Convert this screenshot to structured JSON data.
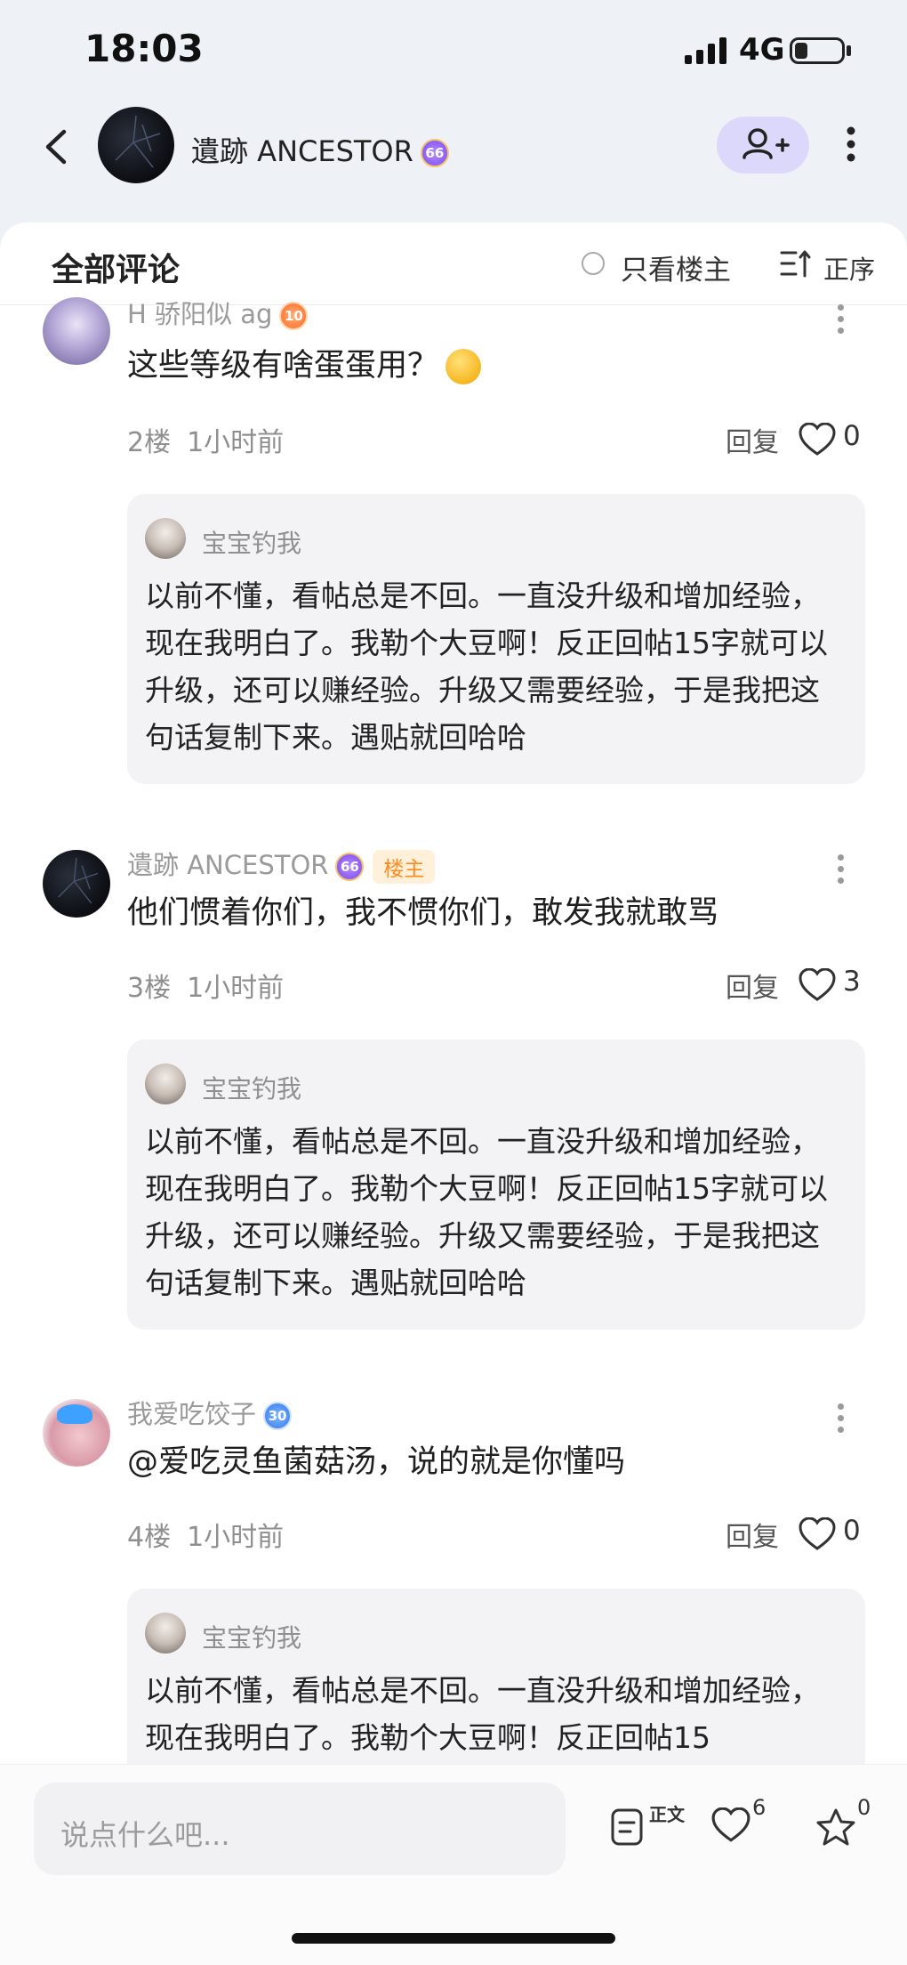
{
  "status_bar": {
    "time": "18:03",
    "network": "4G"
  },
  "header": {
    "title": "遺跡 ANCESTOR",
    "title_level": "66"
  },
  "sort_bar": {
    "label": "全部评论",
    "only_host": "只看楼主",
    "order": "正序"
  },
  "comments": [
    {
      "name": "H 骄阳似 ag",
      "level": "10",
      "text": "这些等级有啥蛋蛋用？",
      "floor": "2楼",
      "time": "1小时前",
      "reply": "回复",
      "likes": "0",
      "quote": {
        "name": "宝宝钓我",
        "text": "以前不懂，看帖总是不回。一直没升级和增加经验，现在我明白了。我勒个大豆啊！反正回帖15字就可以升级，还可以赚经验。升级又需要经验，于是我把这句话复制下来。遇贴就回哈哈"
      }
    },
    {
      "name": "遺跡 ANCESTOR",
      "level": "66",
      "host_tag": "楼主",
      "text": "他们惯着你们，我不惯你们，敢发我就敢骂",
      "floor": "3楼",
      "time": "1小时前",
      "reply": "回复",
      "likes": "3",
      "quote": {
        "name": "宝宝钓我",
        "text": "以前不懂，看帖总是不回。一直没升级和增加经验，现在我明白了。我勒个大豆啊！反正回帖15字就可以升级，还可以赚经验。升级又需要经验，于是我把这句话复制下来。遇贴就回哈哈"
      }
    },
    {
      "name": "我爱吃饺子",
      "level": "30",
      "text": "@爱吃灵鱼菌菇汤，说的就是你懂吗",
      "floor": "4楼",
      "time": "1小时前",
      "reply": "回复",
      "likes": "0",
      "quote": {
        "name": "宝宝钓我",
        "text": "以前不懂，看帖总是不回。一直没升级和增加经验，现在我明白了。我勒个大豆啊！反正回帖15"
      }
    }
  ],
  "bottom_bar": {
    "input_placeholder": "说点什么吧...",
    "text_label": "正文",
    "like_count": "6",
    "fav_count": "0"
  },
  "icons": [
    "back-arrow-icon",
    "follow-user-icon",
    "more-vertical-icon",
    "sort-order-icon",
    "heart-icon",
    "article-icon",
    "star-icon"
  ],
  "colors": {
    "accent": "#dcd8fb",
    "host_tag": "#ff8a1f",
    "background": "#eef2f7"
  }
}
